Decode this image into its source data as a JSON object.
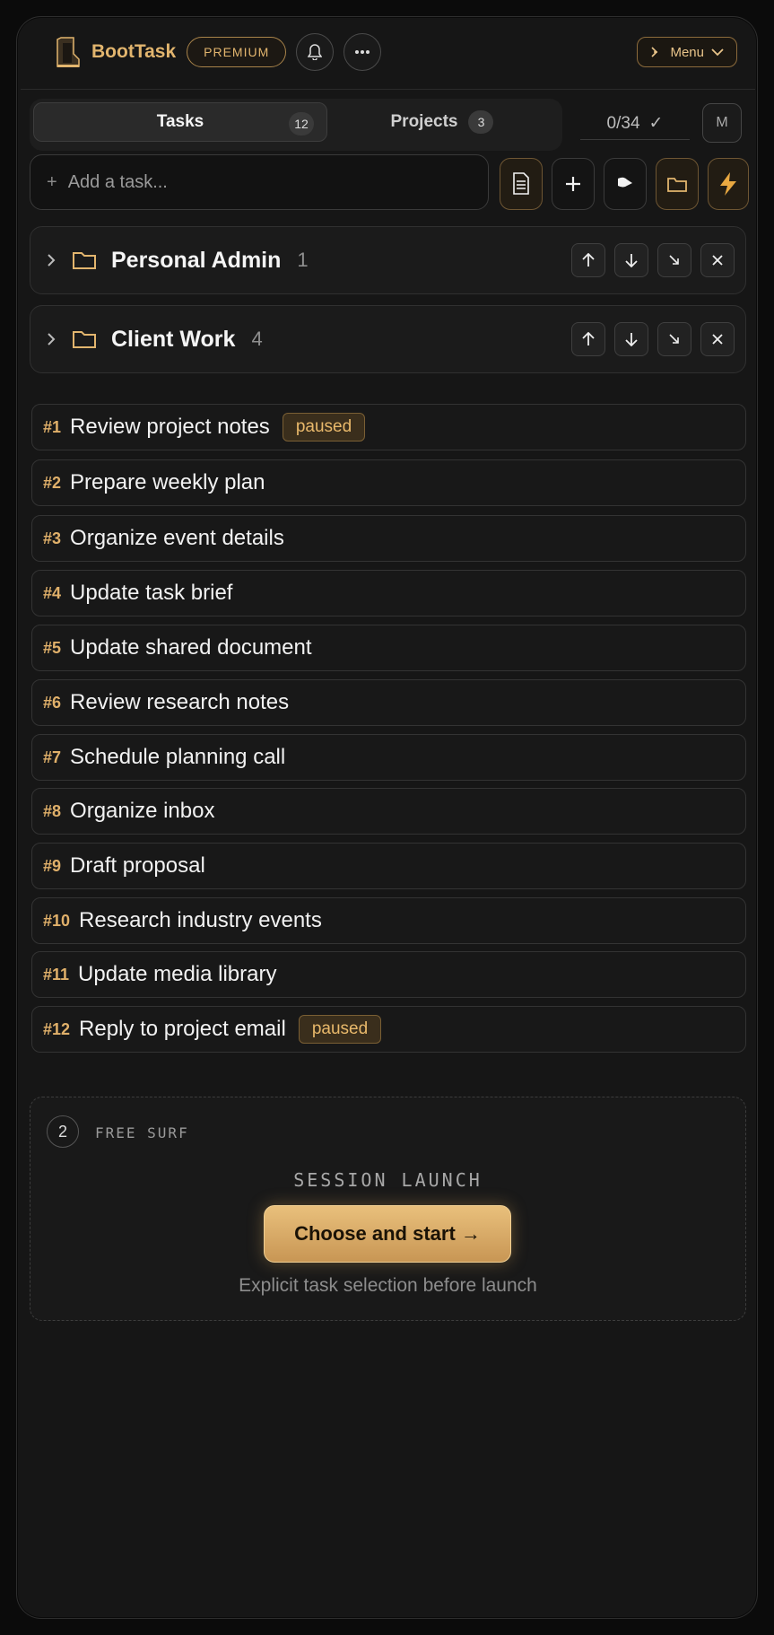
{
  "header": {
    "brand": "BootTask",
    "premium_label": "PREMIUM",
    "menu_label": "Menu",
    "accent_color": "#e2b56e"
  },
  "tabs": [
    {
      "label": "Tasks",
      "count": "12",
      "active": true
    },
    {
      "label": "Projects",
      "count": "3",
      "active": false
    }
  ],
  "progress": {
    "text": "0/34",
    "mark": "✓"
  },
  "user_badge": "M",
  "add_task": {
    "placeholder": "Add a task..."
  },
  "toolbar": [
    "document-icon",
    "plus-icon",
    "flag-icon",
    "folder-icon",
    "lightning-icon"
  ],
  "folders": [
    {
      "name": "Personal Admin",
      "count": "1"
    },
    {
      "name": "Client Work",
      "count": "4"
    }
  ],
  "tasks": [
    {
      "num": "#1",
      "title": "Review project notes",
      "badge": "paused"
    },
    {
      "num": "#2",
      "title": "Prepare weekly plan",
      "badge": ""
    },
    {
      "num": "#3",
      "title": "Organize event details",
      "badge": ""
    },
    {
      "num": "#4",
      "title": "Update task brief",
      "badge": ""
    },
    {
      "num": "#5",
      "title": "Update shared document",
      "badge": ""
    },
    {
      "num": "#6",
      "title": "Review research notes",
      "badge": ""
    },
    {
      "num": "#7",
      "title": "Schedule planning call",
      "badge": ""
    },
    {
      "num": "#8",
      "title": "Organize inbox",
      "badge": ""
    },
    {
      "num": "#9",
      "title": "Draft proposal",
      "badge": ""
    },
    {
      "num": "#10",
      "title": "Research industry events",
      "badge": ""
    },
    {
      "num": "#11",
      "title": "Update media library",
      "badge": ""
    },
    {
      "num": "#12",
      "title": "Reply to project email",
      "badge": "paused"
    }
  ],
  "session": {
    "step": "2",
    "mode_label": "FREE SURF",
    "title": "SESSION LAUNCH",
    "cta_label": "Choose and start →",
    "hint": "Explicit task selection before launch"
  }
}
